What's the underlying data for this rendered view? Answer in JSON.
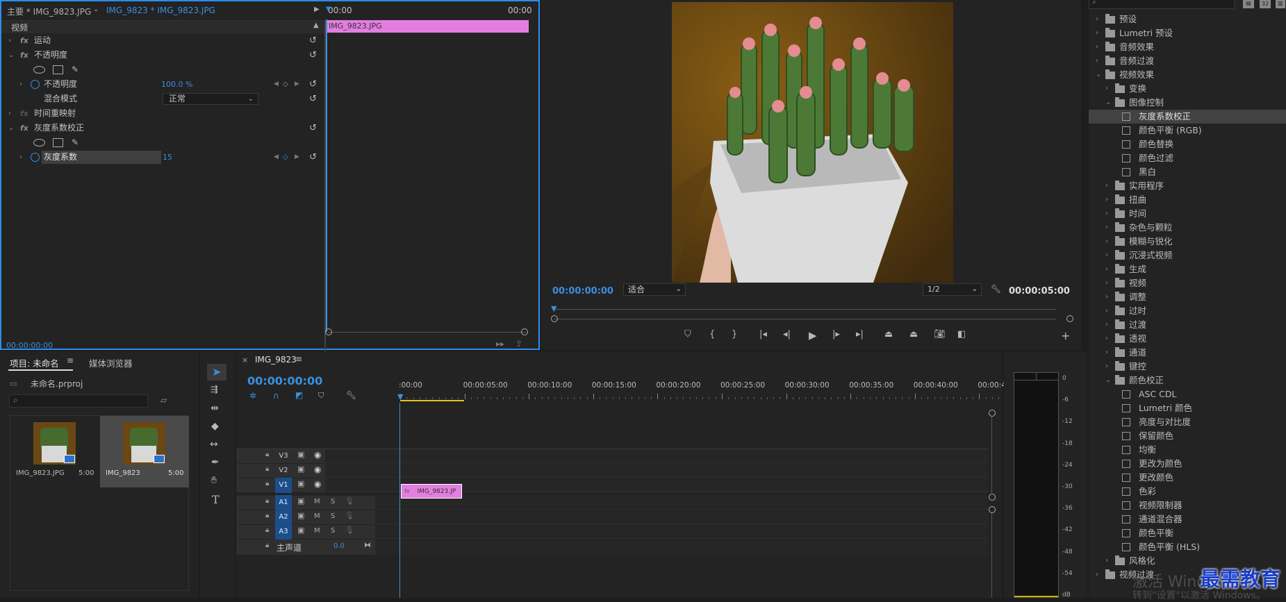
{
  "effect_controls": {
    "tab_master": "主要 * IMG_9823.JPG",
    "tab_clip": "IMG_9823 * IMG_9823.JPG",
    "time_start": "00:00",
    "time_end": "00:00",
    "clip_name": "IMG_9823.JPG",
    "section_video": "视频",
    "motion": "运动",
    "opacity": "不透明度",
    "opacity_param": "不透明度",
    "opacity_value": "100.0 %",
    "blend_label": "混合模式",
    "blend_value": "正常",
    "time_remap": "时间重映射",
    "gamma_effect": "灰度系数校正",
    "gamma_param": "灰度系数",
    "gamma_value": "15",
    "current_time": "00:00:00:00"
  },
  "program": {
    "timecode": "00:00:00:00",
    "fit": "适合",
    "resolution": "1/2",
    "duration": "00:00:05:00"
  },
  "project": {
    "tab": "项目: 未命名",
    "media_tab": "媒体浏览器",
    "file": "未命名.prproj",
    "items": [
      {
        "name": "IMG_9823.JPG",
        "dur": "5:00"
      },
      {
        "name": "IMG_9823",
        "dur": "5:00"
      }
    ]
  },
  "timeline": {
    "tab": "IMG_9823",
    "timecode": "00:00:00:00",
    "ruler": [
      ":00:00",
      "00:00:05:00",
      "00:00:10:00",
      "00:00:15:00",
      "00:00:20:00",
      "00:00:25:00",
      "00:00:30:00",
      "00:00:35:00",
      "00:00:40:00",
      "00:00:4"
    ],
    "tracks": [
      "V3",
      "V2",
      "V1",
      "A1",
      "A2",
      "A3"
    ],
    "m": "M",
    "s": "S",
    "master": "主声道",
    "master_val": "0.0",
    "clip": "IMG_9823.JP"
  },
  "meter": {
    "labels": [
      "0",
      "-6",
      "-12",
      "-18",
      "-24",
      "-30",
      "-36",
      "-42",
      "-48",
      "-54",
      "dB"
    ]
  },
  "effects": {
    "items": [
      {
        "t": "预设",
        "lv": 0,
        "k": "folder"
      },
      {
        "t": "Lumetri 预设",
        "lv": 0,
        "k": "folder"
      },
      {
        "t": "音频效果",
        "lv": 0,
        "k": "folder"
      },
      {
        "t": "音频过渡",
        "lv": 0,
        "k": "folder"
      },
      {
        "t": "视频效果",
        "lv": 0,
        "k": "folder",
        "open": true
      },
      {
        "t": "变换",
        "lv": 1,
        "k": "folder"
      },
      {
        "t": "图像控制",
        "lv": 1,
        "k": "folder",
        "open": true
      },
      {
        "t": "灰度系数校正",
        "lv": 2,
        "k": "fx",
        "sel": true
      },
      {
        "t": "颜色平衡 (RGB)",
        "lv": 2,
        "k": "fx"
      },
      {
        "t": "颜色替换",
        "lv": 2,
        "k": "fx"
      },
      {
        "t": "颜色过滤",
        "lv": 2,
        "k": "fx"
      },
      {
        "t": "黑白",
        "lv": 2,
        "k": "fx"
      },
      {
        "t": "实用程序",
        "lv": 1,
        "k": "folder"
      },
      {
        "t": "扭曲",
        "lv": 1,
        "k": "folder"
      },
      {
        "t": "时间",
        "lv": 1,
        "k": "folder"
      },
      {
        "t": "杂色与颗粒",
        "lv": 1,
        "k": "folder"
      },
      {
        "t": "模糊与锐化",
        "lv": 1,
        "k": "folder"
      },
      {
        "t": "沉浸式视频",
        "lv": 1,
        "k": "folder"
      },
      {
        "t": "生成",
        "lv": 1,
        "k": "folder"
      },
      {
        "t": "视频",
        "lv": 1,
        "k": "folder"
      },
      {
        "t": "调整",
        "lv": 1,
        "k": "folder"
      },
      {
        "t": "过时",
        "lv": 1,
        "k": "folder"
      },
      {
        "t": "过渡",
        "lv": 1,
        "k": "folder"
      },
      {
        "t": "透视",
        "lv": 1,
        "k": "folder"
      },
      {
        "t": "通道",
        "lv": 1,
        "k": "folder"
      },
      {
        "t": "键控",
        "lv": 1,
        "k": "folder"
      },
      {
        "t": "颜色校正",
        "lv": 1,
        "k": "folder",
        "open": true
      },
      {
        "t": "ASC CDL",
        "lv": 2,
        "k": "fx"
      },
      {
        "t": "Lumetri 颜色",
        "lv": 2,
        "k": "fx"
      },
      {
        "t": "亮度与对比度",
        "lv": 2,
        "k": "fx"
      },
      {
        "t": "保留颜色",
        "lv": 2,
        "k": "fx"
      },
      {
        "t": "均衡",
        "lv": 2,
        "k": "fx"
      },
      {
        "t": "更改为颜色",
        "lv": 2,
        "k": "fx"
      },
      {
        "t": "更改颜色",
        "lv": 2,
        "k": "fx"
      },
      {
        "t": "色彩",
        "lv": 2,
        "k": "fx"
      },
      {
        "t": "视频限制器",
        "lv": 2,
        "k": "fx"
      },
      {
        "t": "通道混合器",
        "lv": 2,
        "k": "fx"
      },
      {
        "t": "颜色平衡",
        "lv": 2,
        "k": "fx"
      },
      {
        "t": "颜色平衡 (HLS)",
        "lv": 2,
        "k": "fx"
      },
      {
        "t": "风格化",
        "lv": 1,
        "k": "folder"
      },
      {
        "t": "视频过渡",
        "lv": 0,
        "k": "folder"
      }
    ],
    "badge_32": "32"
  },
  "watermark": {
    "activate": "激活 Windows",
    "goto": "转到\"设置\"以激活 Windows。",
    "logo": "最需教育"
  }
}
